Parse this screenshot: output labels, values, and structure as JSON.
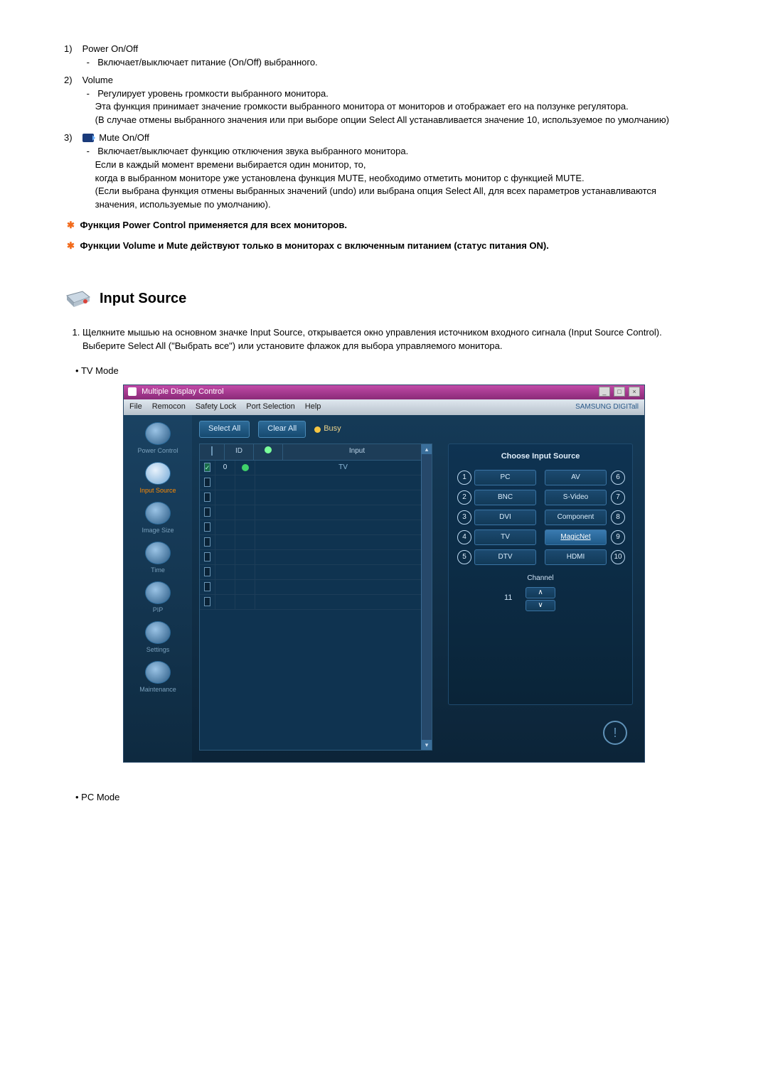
{
  "list": {
    "item1": {
      "num": "1)",
      "title": "Power On/Off",
      "desc": "Включает/выключает питание (On/Off) выбранного."
    },
    "item2": {
      "num": "2)",
      "title": "Volume",
      "lines": [
        "Регулирует уровень громкости выбранного монитора.",
        "Эта функция принимает значение громкости выбранного монитора от мониторов и отображает его на ползунке регулятора.",
        "(В случае отмены выбранного значения или при выборе опции Select All устанавливается значение 10, используемое по умолчанию)"
      ]
    },
    "item3": {
      "num": "3)",
      "title": "Mute On/Off",
      "lines": [
        "Включает/выключает функцию отключения звука выбранного монитора.",
        "Если в каждый момент времени выбирается один монитор, то,",
        "когда в выбранном мониторе уже установлена функция MUTE, необходимо отметить монитор с функцией MUTE.",
        "(Если выбрана функция отмены выбранных значений (undo) или выбрана опция Select All, для всех параметров устанавливаются значения, используемые по умолчанию)."
      ]
    }
  },
  "notes": {
    "n1": "Функция Power Control применяется для всех мониторов.",
    "n2": "Функции Volume и Mute действуют только в мониторах с включенным питанием (статус питания ON)."
  },
  "section": {
    "title": "Input Source"
  },
  "input_steps": {
    "s1a": "Щелкните мышью на основном значке Input Source, открывается окно управления источником входного сигнала (Input Source Control).",
    "s1b": "Выберите Select All (\"Выбрать все\") или установите флажок для выбора управляемого монитора."
  },
  "bullets": {
    "tv": "TV Mode",
    "pc": "PC Mode"
  },
  "app": {
    "title": "Multiple Display Control",
    "menu": [
      "File",
      "Remocon",
      "Safety Lock",
      "Port Selection",
      "Help"
    ],
    "brand": "SAMSUNG DIGITall",
    "toolbar": {
      "select_all": "Select All",
      "clear_all": "Clear All",
      "busy": "Busy"
    },
    "sidebar": [
      "Power Control",
      "Input Source",
      "Image Size",
      "Time",
      "PIP",
      "Settings",
      "Maintenance"
    ],
    "grid": {
      "headers": {
        "chk": "",
        "id": "ID",
        "st": "",
        "input": "Input"
      },
      "rows": [
        {
          "chk": true,
          "id": "0",
          "st": true,
          "input": "TV"
        },
        {
          "chk": false,
          "id": "",
          "st": false,
          "input": ""
        },
        {
          "chk": false,
          "id": "",
          "st": false,
          "input": ""
        },
        {
          "chk": false,
          "id": "",
          "st": false,
          "input": ""
        },
        {
          "chk": false,
          "id": "",
          "st": false,
          "input": ""
        },
        {
          "chk": false,
          "id": "",
          "st": false,
          "input": ""
        },
        {
          "chk": false,
          "id": "",
          "st": false,
          "input": ""
        },
        {
          "chk": false,
          "id": "",
          "st": false,
          "input": ""
        },
        {
          "chk": false,
          "id": "",
          "st": false,
          "input": ""
        },
        {
          "chk": false,
          "id": "",
          "st": false,
          "input": ""
        }
      ]
    },
    "panel": {
      "title": "Choose Input Source",
      "left": [
        {
          "n": "1",
          "l": "PC"
        },
        {
          "n": "2",
          "l": "BNC"
        },
        {
          "n": "3",
          "l": "DVI"
        },
        {
          "n": "4",
          "l": "TV"
        },
        {
          "n": "5",
          "l": "DTV"
        }
      ],
      "right": [
        {
          "n": "6",
          "l": "AV"
        },
        {
          "n": "7",
          "l": "S-Video"
        },
        {
          "n": "8",
          "l": "Component"
        },
        {
          "n": "9",
          "l": "MagicNet"
        },
        {
          "n": "10",
          "l": "HDMI"
        }
      ],
      "channel": {
        "n": "11",
        "label": "Channel",
        "up": "∧",
        "down": "∨"
      }
    }
  }
}
